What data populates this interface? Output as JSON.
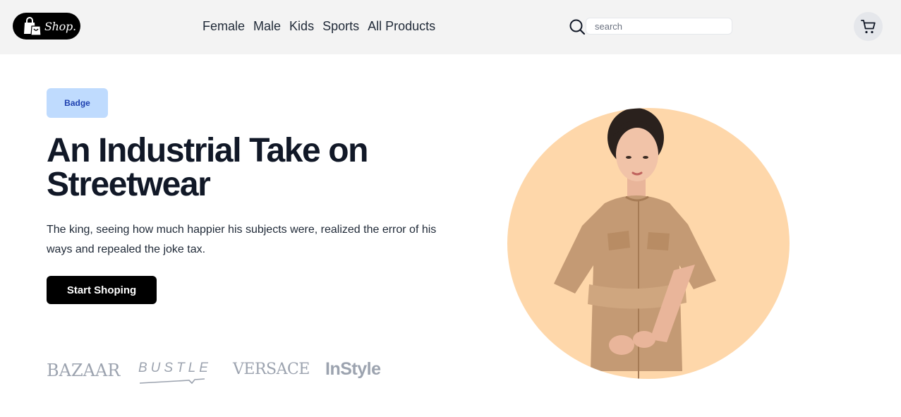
{
  "header": {
    "logo_text": "Shop.",
    "nav": [
      "Female",
      "Male",
      "Kids",
      "Sports",
      "All Products"
    ],
    "search_placeholder": "search"
  },
  "hero": {
    "badge": "Badge",
    "title": "An Industrial Take on Streetwear",
    "description": "The king, seeing how much happier his subjects were, realized the error of his ways and repealed the joke tax.",
    "cta_label": "Start Shoping"
  },
  "brands": [
    "BAZAAR",
    "BUSTLE",
    "VERSACE",
    "InStyle"
  ],
  "colors": {
    "header_bg": "#f3f3f3",
    "badge_bg": "#bfdbfe",
    "badge_text": "#1e40af",
    "hero_circle": "#fed7aa",
    "cta_bg": "#000000"
  },
  "icons": [
    "shopping-bag-icon",
    "search-icon",
    "cart-icon"
  ]
}
